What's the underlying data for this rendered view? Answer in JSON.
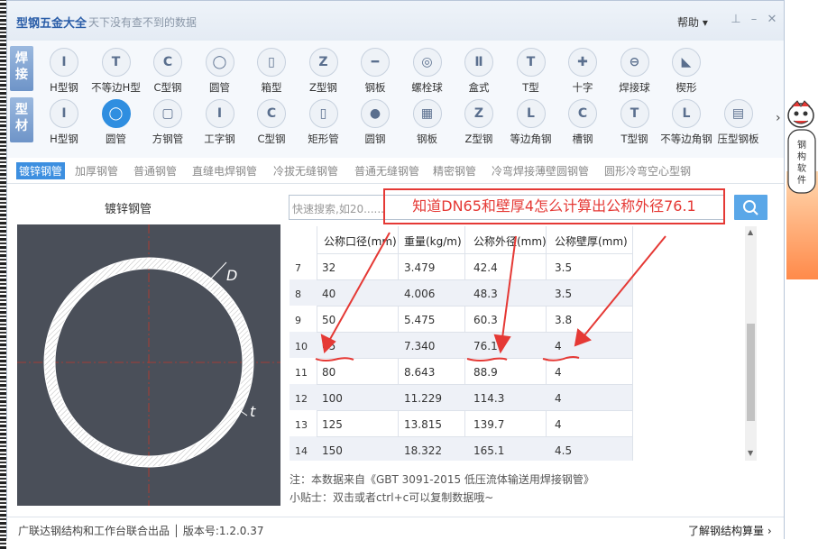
{
  "app": {
    "title": "型钢五金大全",
    "slogan": "天下没有查不到的数据",
    "help": "帮助"
  },
  "vtabs": [
    {
      "label": "焊接"
    },
    {
      "label": "型材"
    }
  ],
  "row1": [
    {
      "icon": "h-beam-icon",
      "glyph": "I",
      "label": "H型钢"
    },
    {
      "icon": "unequal-h-beam-icon",
      "glyph": "T",
      "label": "不等边H型"
    },
    {
      "icon": "c-channel-icon",
      "glyph": "C",
      "label": "C型钢"
    },
    {
      "icon": "round-tube-icon",
      "glyph": "◯",
      "label": "圆管"
    },
    {
      "icon": "box-beam-icon",
      "glyph": "▯",
      "label": "箱型"
    },
    {
      "icon": "z-section-icon",
      "glyph": "Z",
      "label": "Z型钢"
    },
    {
      "icon": "steel-plate-icon",
      "glyph": "━",
      "label": "钢板"
    },
    {
      "icon": "bolt-ball-icon",
      "glyph": "◎",
      "label": "螺栓球"
    },
    {
      "icon": "box-section-icon",
      "glyph": "Ⅱ",
      "label": "盒式"
    },
    {
      "icon": "t-section-icon",
      "glyph": "T",
      "label": "T型"
    },
    {
      "icon": "cross-section-icon",
      "glyph": "✚",
      "label": "十字"
    },
    {
      "icon": "weld-ball-icon",
      "glyph": "⊖",
      "label": "焊接球"
    },
    {
      "icon": "wedge-icon",
      "glyph": "◣",
      "label": "楔形"
    }
  ],
  "row2": [
    {
      "icon": "h-beam-icon",
      "glyph": "I",
      "label": "H型钢"
    },
    {
      "icon": "round-pipe-icon",
      "glyph": "◯",
      "label": "圆管",
      "selected": true
    },
    {
      "icon": "square-pipe-icon",
      "glyph": "▢",
      "label": "方钢管"
    },
    {
      "icon": "i-beam-icon",
      "glyph": "I",
      "label": "工字钢"
    },
    {
      "icon": "c-channel-icon",
      "glyph": "C",
      "label": "C型钢"
    },
    {
      "icon": "rect-pipe-icon",
      "glyph": "▯",
      "label": "矩形管"
    },
    {
      "icon": "round-bar-icon",
      "glyph": "●",
      "label": "圆钢"
    },
    {
      "icon": "steel-plate-icon",
      "glyph": "▦",
      "label": "钢板"
    },
    {
      "icon": "z-section-icon",
      "glyph": "Z",
      "label": "Z型钢"
    },
    {
      "icon": "equal-angle-icon",
      "glyph": "L",
      "label": "等边角钢"
    },
    {
      "icon": "channel-icon",
      "glyph": "C",
      "label": "槽钢"
    },
    {
      "icon": "t-section-icon",
      "glyph": "T",
      "label": "T型钢"
    },
    {
      "icon": "unequal-angle-icon",
      "glyph": "L",
      "label": "不等边角钢"
    },
    {
      "icon": "deck-plate-icon",
      "glyph": "▤",
      "label": "压型钢板"
    }
  ],
  "subtabs": [
    "镀锌钢管",
    "加厚钢管",
    "普通钢管",
    "直缝电焊钢管",
    "冷拔无缝钢管",
    "普通无缝钢管",
    "精密钢管",
    "冷弯焊接薄壁圆钢管",
    "圆形冷弯空心型钢"
  ],
  "panel_title": "镀锌钢管",
  "diagram": {
    "label_d": "D",
    "label_t": "t"
  },
  "search": {
    "placeholder": "快速搜索,如20......"
  },
  "annotation": "知道DN65和壁厚4怎么计算出公称外径76.1",
  "table": {
    "headers": [
      "公称口径(mm)",
      "重量(kg/m)",
      "公称外径(mm)",
      "公称壁厚(mm)"
    ],
    "rows": [
      {
        "idx": "7",
        "dn": "32",
        "w": "3.479",
        "od": "42.4",
        "t": "3.5"
      },
      {
        "idx": "8",
        "dn": "40",
        "w": "4.006",
        "od": "48.3",
        "t": "3.5"
      },
      {
        "idx": "9",
        "dn": "50",
        "w": "5.475",
        "od": "60.3",
        "t": "3.8"
      },
      {
        "idx": "10",
        "dn": "65",
        "w": "7.340",
        "od": "76.1",
        "t": "4"
      },
      {
        "idx": "11",
        "dn": "80",
        "w": "8.643",
        "od": "88.9",
        "t": "4"
      },
      {
        "idx": "12",
        "dn": "100",
        "w": "11.229",
        "od": "114.3",
        "t": "4"
      },
      {
        "idx": "13",
        "dn": "125",
        "w": "13.815",
        "od": "139.7",
        "t": "4"
      },
      {
        "idx": "14",
        "dn": "150",
        "w": "18.322",
        "od": "165.1",
        "t": "4.5"
      }
    ]
  },
  "notes": [
    "注：本数据来自《GBT 3091-2015 低压流体输送用焊接钢管》",
    "小贴士：双击或者ctrl+c可以复制数据哦~"
  ],
  "status": {
    "left": "广联达钢结构和工作台联合出品 │ 版本号:1.2.0.37",
    "right": "了解钢结构算量"
  },
  "side_ad": {
    "text": "钢构软件"
  },
  "colors": {
    "accent": "#2f8ee0",
    "annotation": "#e53935",
    "brand": "#2a5da8"
  }
}
